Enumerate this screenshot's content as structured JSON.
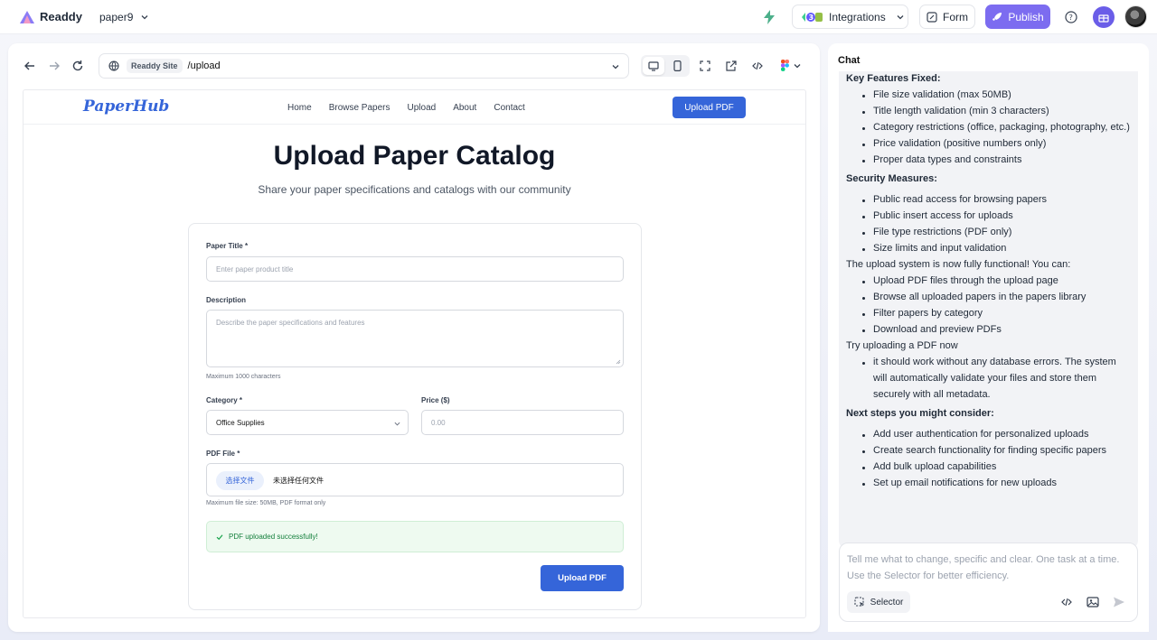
{
  "topbar": {
    "logo_text": "Readdy",
    "project_name": "paper9",
    "integrations_label": "Integrations",
    "form_label": "Form",
    "publish_label": "Publish"
  },
  "browser": {
    "site_chip": "Readdy Site",
    "url_path": "/upload"
  },
  "site": {
    "brand": "PaperHub",
    "nav": [
      "Home",
      "Browse Papers",
      "Upload",
      "About",
      "Contact"
    ],
    "header_button": "Upload PDF",
    "title": "Upload Paper Catalog",
    "subtitle": "Share your paper specifications and catalogs with our community",
    "form": {
      "title_label": "Paper Title *",
      "title_placeholder": "Enter paper product title",
      "description_label": "Description",
      "description_placeholder": "Describe the paper specifications and features",
      "description_hint": "Maximum 1000 characters",
      "category_label": "Category *",
      "category_value": "Office Supplies",
      "price_label": "Price ($)",
      "price_placeholder": "0.00",
      "file_label": "PDF File *",
      "file_button": "选择文件",
      "file_status": "未选择任何文件",
      "file_hint": "Maximum file size: 50MB, PDF format only",
      "success_message": "PDF uploaded successfully!",
      "submit_label": "Upload PDF"
    }
  },
  "chat": {
    "title": "Chat",
    "lines": [
      {
        "text": "Key Features Fixed:",
        "bold": true,
        "bullet": false
      },
      {
        "text": "File size validation (max 50MB)",
        "bold": false,
        "bullet": true
      },
      {
        "text": "Title length validation (min 3 characters)",
        "bold": false,
        "bullet": true
      },
      {
        "text": "Category restrictions (office, packaging, photography, etc.)",
        "bold": false,
        "bullet": true
      },
      {
        "text": "Price validation (positive numbers only)",
        "bold": false,
        "bullet": true
      },
      {
        "text": "Proper data types and constraints",
        "bold": false,
        "bullet": true
      },
      {
        "text": "Security Measures:",
        "bold": true,
        "bullet": false
      },
      {
        "text": "Public read access for browsing papers",
        "bold": false,
        "bullet": true
      },
      {
        "text": "Public insert access for uploads",
        "bold": false,
        "bullet": true
      },
      {
        "text": "File type restrictions (PDF only)",
        "bold": false,
        "bullet": true
      },
      {
        "text": "Size limits and input validation",
        "bold": false,
        "bullet": true
      },
      {
        "text": "The upload system is now fully functional! You can:",
        "bold": false,
        "bullet": false
      },
      {
        "text": "Upload PDF files through the upload page",
        "bold": false,
        "bullet": true
      },
      {
        "text": "Browse all uploaded papers in the papers library",
        "bold": false,
        "bullet": true
      },
      {
        "text": "Filter papers by category",
        "bold": false,
        "bullet": true
      },
      {
        "text": "Download and preview PDFs",
        "bold": false,
        "bullet": true
      },
      {
        "text": "Try uploading a PDF now",
        "bold": false,
        "bullet": false
      },
      {
        "text": "it should work without any database errors. The system",
        "bold": false,
        "bullet": true
      },
      {
        "text": "will automatically validate your files and store them",
        "bold": false,
        "bullet": false
      },
      {
        "text": "securely with all metadata.",
        "bold": false,
        "bullet": false
      },
      {
        "text": "Next steps you might consider:",
        "bold": true,
        "bullet": false
      },
      {
        "text": "Add user authentication for personalized uploads",
        "bold": false,
        "bullet": true
      },
      {
        "text": "Create search functionality for finding specific papers",
        "bold": false,
        "bullet": true
      },
      {
        "text": "Add bulk upload capabilities",
        "bold": false,
        "bullet": true
      },
      {
        "text": "Set up email notifications for new uploads",
        "bold": false,
        "bullet": true
      }
    ],
    "composer_placeholder": "Tell me what to change, specific and clear. One task at a time. Use the Selector for better efficiency.",
    "selector_label": "Selector"
  },
  "colors": {
    "brand_blue": "#3565d9",
    "publish_purple": "#7c6cf0",
    "success_green": "#15803d"
  }
}
